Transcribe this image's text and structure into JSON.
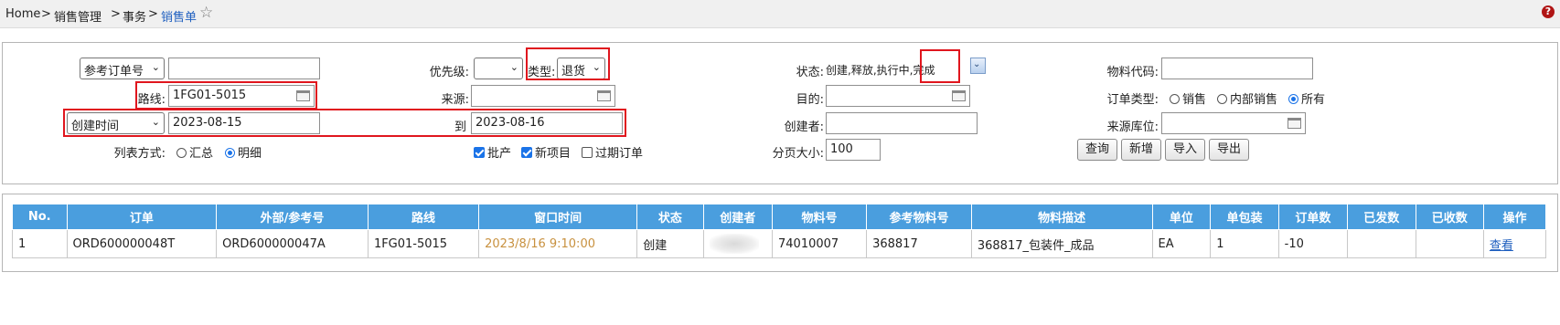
{
  "breadcrumb": {
    "home": "Home",
    "sep": ">",
    "level1": "销售管理",
    "level2": "事务",
    "current": "销售单"
  },
  "help_icon": "?",
  "form": {
    "ref_order_select": "参考订单号",
    "ref_order_value": "",
    "route_label": "路线:",
    "route_value": "1FG01-5015",
    "date_field_select": "创建时间",
    "date_from": "2023-08-15",
    "to_label": "到",
    "date_to": "2023-08-16",
    "list_mode_label": "列表方式:",
    "list_mode_summary": "汇总",
    "list_mode_detail": "明细",
    "list_mode_selected": "明细",
    "priority_label": "优先级:",
    "priority_value": "",
    "type_label": "类型:",
    "type_value": "退货",
    "source_label": "来源:",
    "source_value": "",
    "cb_batch": "批产",
    "cb_batch_checked": true,
    "cb_new": "新项目",
    "cb_new_checked": true,
    "cb_expired": "过期订单",
    "cb_expired_checked": false,
    "status_label": "状态:",
    "status_value": "创建,释放,执行中,完成",
    "dest_label": "目的:",
    "dest_value": "",
    "creator_label": "创建者:",
    "creator_value": "",
    "page_size_label": "分页大小:",
    "page_size_value": "100",
    "material_code_label": "物料代码:",
    "material_code_value": "",
    "order_type_label": "订单类型:",
    "order_type_sales": "销售",
    "order_type_internal": "内部销售",
    "order_type_all": "所有",
    "order_type_selected": "所有",
    "source_loc_label": "来源库位:",
    "source_loc_value": ""
  },
  "buttons": {
    "query": "查询",
    "add": "新增",
    "import": "导入",
    "export": "导出"
  },
  "table": {
    "headers": [
      "No.",
      "订单",
      "外部/参考号",
      "路线",
      "窗口时间",
      "状态",
      "创建者",
      "物料号",
      "参考物料号",
      "物料描述",
      "单位",
      "单包装",
      "订单数",
      "已发数",
      "已收数",
      "操作"
    ],
    "rows": [
      {
        "no": "1",
        "order": "ORD600000048T",
        "external_ref": "ORD600000047A",
        "route": "1FG01-5015",
        "window_time": "2023/8/16 9:10:00",
        "status": "创建",
        "creator": "",
        "material_no": "74010007",
        "ref_material_no": "368817",
        "material_desc": "368817_包装件_成品",
        "unit": "EA",
        "pack": "1",
        "order_qty": "-10",
        "shipped_qty": "",
        "received_qty": "",
        "action": "查看"
      }
    ]
  },
  "colors": {
    "header_bg": "#4a9ede",
    "highlight": "#e0161e",
    "link": "#1f5fbf",
    "window_time": "#c8913f"
  }
}
